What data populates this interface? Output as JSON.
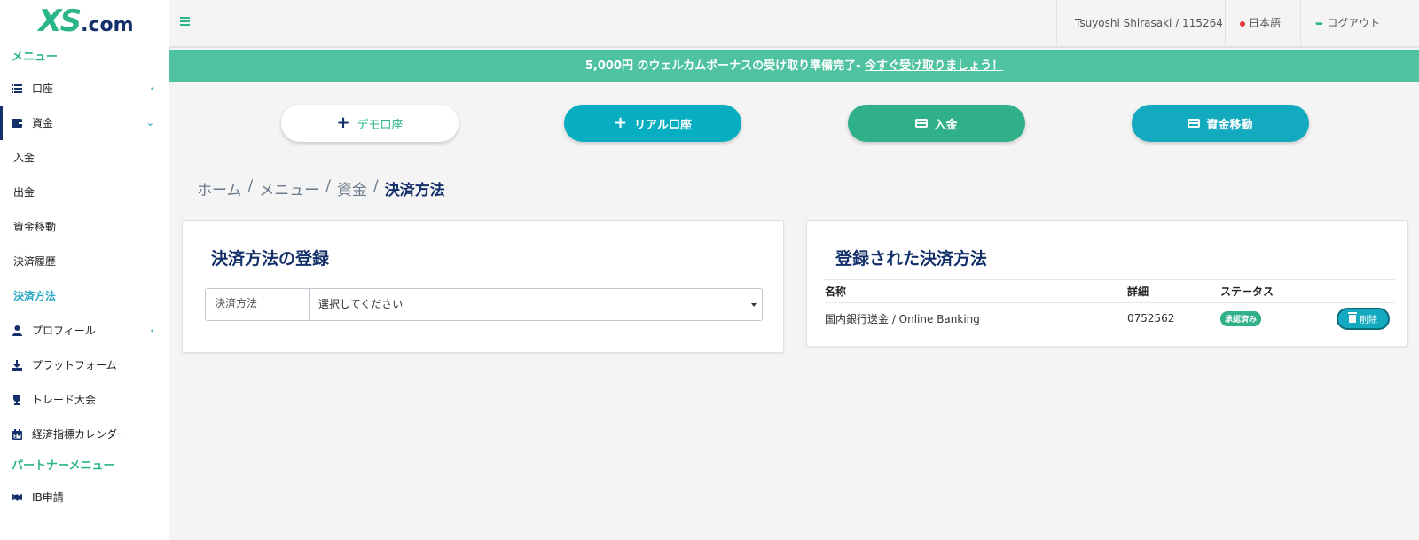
{
  "logo": {
    "brand": "XS",
    "suffix": ".com"
  },
  "sidebar": {
    "menu_heading": "メニュー",
    "items": [
      {
        "label": "口座",
        "chevron": "‹"
      },
      {
        "label": "資金",
        "chevron": "›"
      }
    ],
    "sub_items": [
      "入金",
      "出金",
      "資金移動",
      "決済履歴",
      "決済方法"
    ],
    "items2": [
      {
        "label": "プロフィール",
        "chevron": "‹"
      },
      {
        "label": "プラットフォーム"
      },
      {
        "label": "トレード大会"
      },
      {
        "label": "経済指標カレンダー"
      }
    ],
    "partner_heading": "パートナーメニュー",
    "partner_items": [
      {
        "label": "IB申請"
      }
    ]
  },
  "header": {
    "user": "Tsuyoshi Shirasaki / 115264",
    "language": "日本語",
    "logout": "ログアウト"
  },
  "banner": {
    "text": "5,000円 のウェルカムボーナスの受け取り準備完了- ",
    "link": "今すぐ受け取りましょう！"
  },
  "actions": {
    "demo": "デモ口座",
    "real": "リアル口座",
    "deposit": "入金",
    "transfer": "資金移動"
  },
  "breadcrumb": [
    "ホーム",
    "メニュー",
    "資金",
    "決済方法"
  ],
  "register_card": {
    "title": "決済方法の登録",
    "field_label": "決済方法",
    "select_value": "選択してください"
  },
  "registered_card": {
    "title": "登録された決済方法",
    "columns": [
      "名称",
      "詳細",
      "ステータス"
    ],
    "rows": [
      {
        "name": "国内銀行送金 / Online Banking",
        "detail": "0752562",
        "status": "承認済み",
        "action": "削除"
      }
    ]
  },
  "colors": {
    "brand_green": "#2bb58a",
    "navy": "#14306a",
    "teal": "#13a9be",
    "banner": "#4fc3a0"
  }
}
